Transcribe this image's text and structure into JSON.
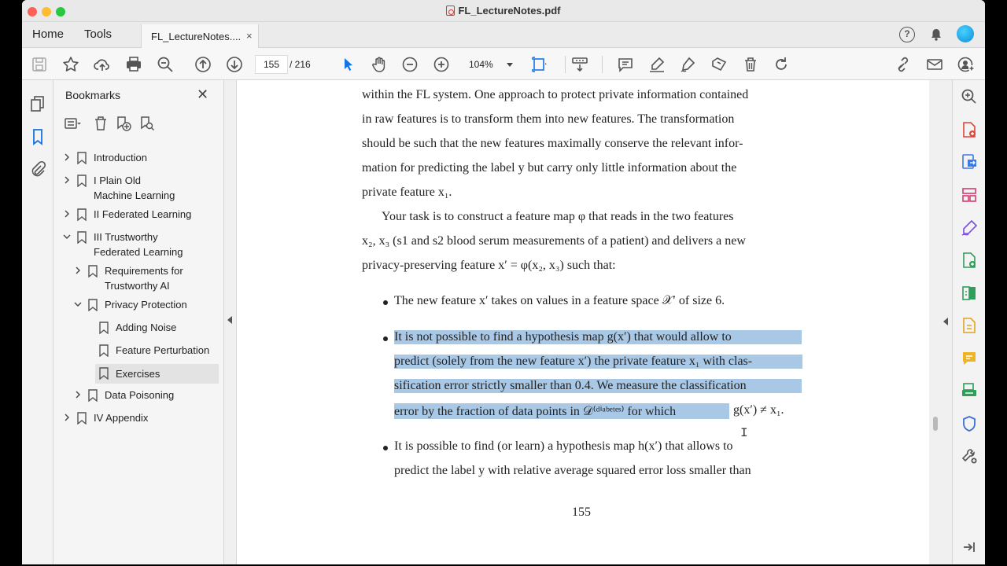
{
  "window": {
    "title": "FL_LectureNotes.pdf"
  },
  "tabs": {
    "home": "Home",
    "tools": "Tools",
    "doc_tab": "FL_LectureNotes....",
    "doc_close": "×",
    "help": "?"
  },
  "toolbar": {
    "page_current": "155",
    "page_total": "/ 216",
    "zoom": "104%"
  },
  "bookmarks": {
    "title": "Bookmarks",
    "close": "✕",
    "items": [
      {
        "label": "Introduction",
        "label2": ""
      },
      {
        "label": "I Plain Old",
        "label2": "Machine Learning"
      },
      {
        "label": "II Federated Learning",
        "label2": ""
      },
      {
        "label": "III Trustworthy",
        "label2": "Federated Learning"
      },
      {
        "label": "Requirements for",
        "label2": "Trustworthy AI"
      },
      {
        "label": "Privacy Protection",
        "label2": ""
      },
      {
        "label": "Adding Noise",
        "label2": ""
      },
      {
        "label": "Feature Perturbation",
        "label2": ""
      },
      {
        "label": "Exercises",
        "label2": ""
      },
      {
        "label": "Data Poisoning",
        "label2": ""
      },
      {
        "label": "IV Appendix",
        "label2": ""
      }
    ]
  },
  "document": {
    "lines": [
      "within the FL system. One approach to protect private information contained",
      "in raw features is to transform them into new features. The transformation",
      "should be such that the new features maximally conserve the relevant infor-",
      "mation for predicting the label y but carry only little information about the",
      "private feature x₁.",
      "Your task is to construct a feature map φ that reads in the two features",
      "x₂, x₃ (s1 and s2 blood serum measurements of a patient) and delivers a new",
      "privacy-preserving feature x′ = φ(x₂, x₃) such that:"
    ],
    "bullet1": "The new feature x′ takes on values in a feature space 𝒳′ of size 6.",
    "bullet2_lines": [
      "It is not possible to find a hypothesis map g(x′) that would allow to",
      "predict (solely from the new feature x′) the private feature x₁ with clas-",
      "sification error strictly smaller than 0.4. We measure the classification",
      "error by the fraction of data points in 𝒟⁽ᵈⁱᵃᵇᵉᵗᵉˢ⁾ for which"
    ],
    "bullet2_tail": "g(x′) ≠ x₁.",
    "bullet3_lines": [
      "It is possible to find (or learn) a hypothesis map h(x′) that allows to",
      "predict the label y with relative average squared error loss smaller than"
    ],
    "page_number": "155"
  },
  "colors": {
    "highlight": "#a9c8e6",
    "accent": "#1473e6"
  }
}
